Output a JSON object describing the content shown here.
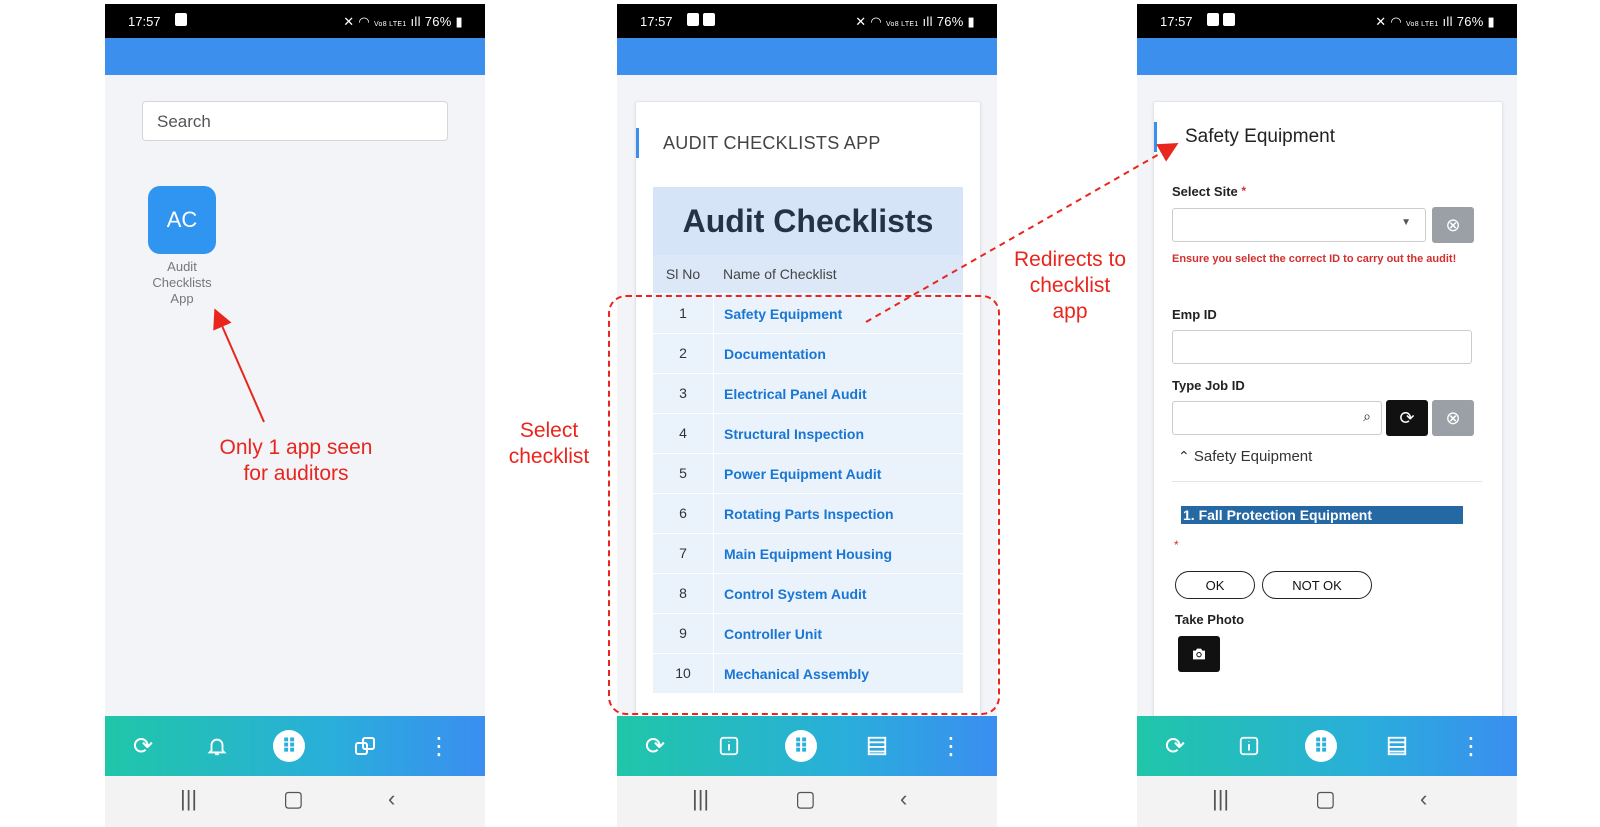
{
  "status_bar": {
    "time": "17:57",
    "battery": "76%",
    "network": "Vo8 LTE1"
  },
  "phone1": {
    "search": {
      "placeholder": "Search"
    },
    "app": {
      "initials": "AC",
      "label": "Audit Checklists App"
    }
  },
  "phone2": {
    "card_title": "AUDIT CHECKLISTS APP",
    "table": {
      "heading": "Audit Checklists",
      "columns": [
        "Sl No",
        "Name of Checklist"
      ],
      "rows": [
        [
          "1",
          "Safety Equipment"
        ],
        [
          "2",
          "Documentation"
        ],
        [
          "3",
          "Electrical Panel Audit"
        ],
        [
          "4",
          "Structural Inspection"
        ],
        [
          "5",
          "Power Equipment Audit"
        ],
        [
          "6",
          "Rotating Parts Inspection"
        ],
        [
          "7",
          "Main Equipment Housing"
        ],
        [
          "8",
          "Control System Audit"
        ],
        [
          "9",
          "Controller Unit"
        ],
        [
          "10",
          "Mechanical Assembly"
        ]
      ]
    }
  },
  "phone3": {
    "form_title": "Safety Equipment",
    "select_site_label": "Select Site",
    "required_mark": "*",
    "warning": "Ensure you select the correct ID to carry out the audit!",
    "emp_id_label": "Emp ID",
    "job_id_label": "Type Job ID",
    "section_label": "Safety Equipment",
    "question": "1. Fall Protection Equipment",
    "ok_label": "OK",
    "not_ok_label": "NOT OK",
    "photo_label": "Take Photo"
  },
  "annotations": {
    "only_one_app": "Only 1 app seen for auditors",
    "select_checklist": "Select checklist",
    "redirects": "Redirects to checklist app"
  },
  "colors": {
    "accent_blue": "#3c8fec",
    "link_blue": "#1976d2",
    "annotation_red": "#e8261e",
    "nav_gradient_start": "#20c6a8",
    "nav_gradient_end": "#3a8ef0"
  }
}
